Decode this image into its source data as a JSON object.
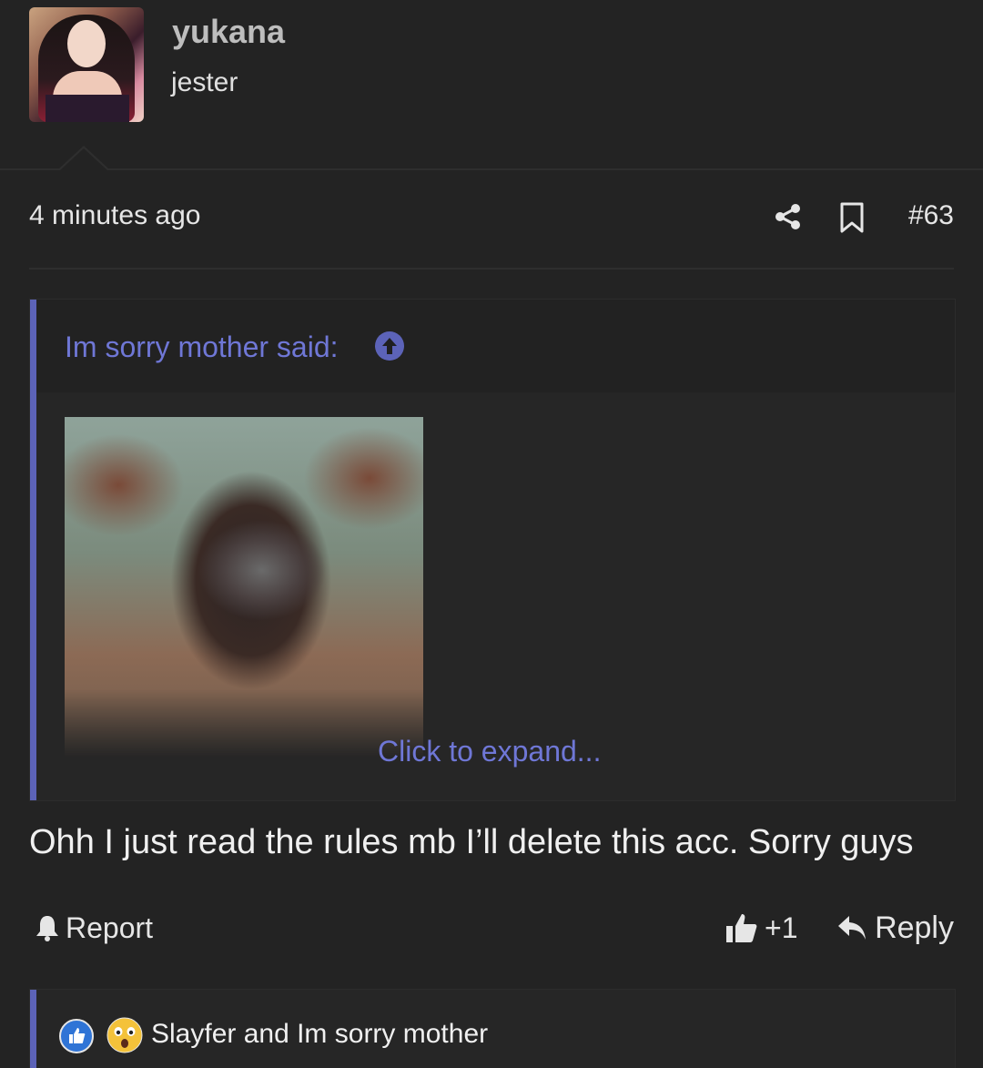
{
  "post": {
    "username": "yukana",
    "user_title": "jester",
    "time": "4 minutes ago",
    "number": "#63",
    "quote": {
      "author_line": "Im sorry mother said:",
      "expand_label": "Click to expand..."
    },
    "message": "Ohh I just read the rules mb I’ll delete this acc. Sorry guys",
    "actions": {
      "report": "Report",
      "like_count": "+1",
      "reply": "Reply"
    },
    "reactions_text": "Slayfer and Im sorry mother"
  },
  "icons": {
    "share": "share-icon",
    "bookmark": "bookmark-icon",
    "quote_jump": "arrow-up-circle-icon",
    "report": "bell-icon",
    "like": "thumbs-up-icon",
    "reply": "reply-arrow-icon",
    "reaction_like": "thumbs-up-reaction-icon",
    "reaction_wow": "wow-emoji-icon"
  },
  "colors": {
    "background": "#232323",
    "accent": "#6f77d6",
    "quote_bar": "#5c63b8"
  }
}
